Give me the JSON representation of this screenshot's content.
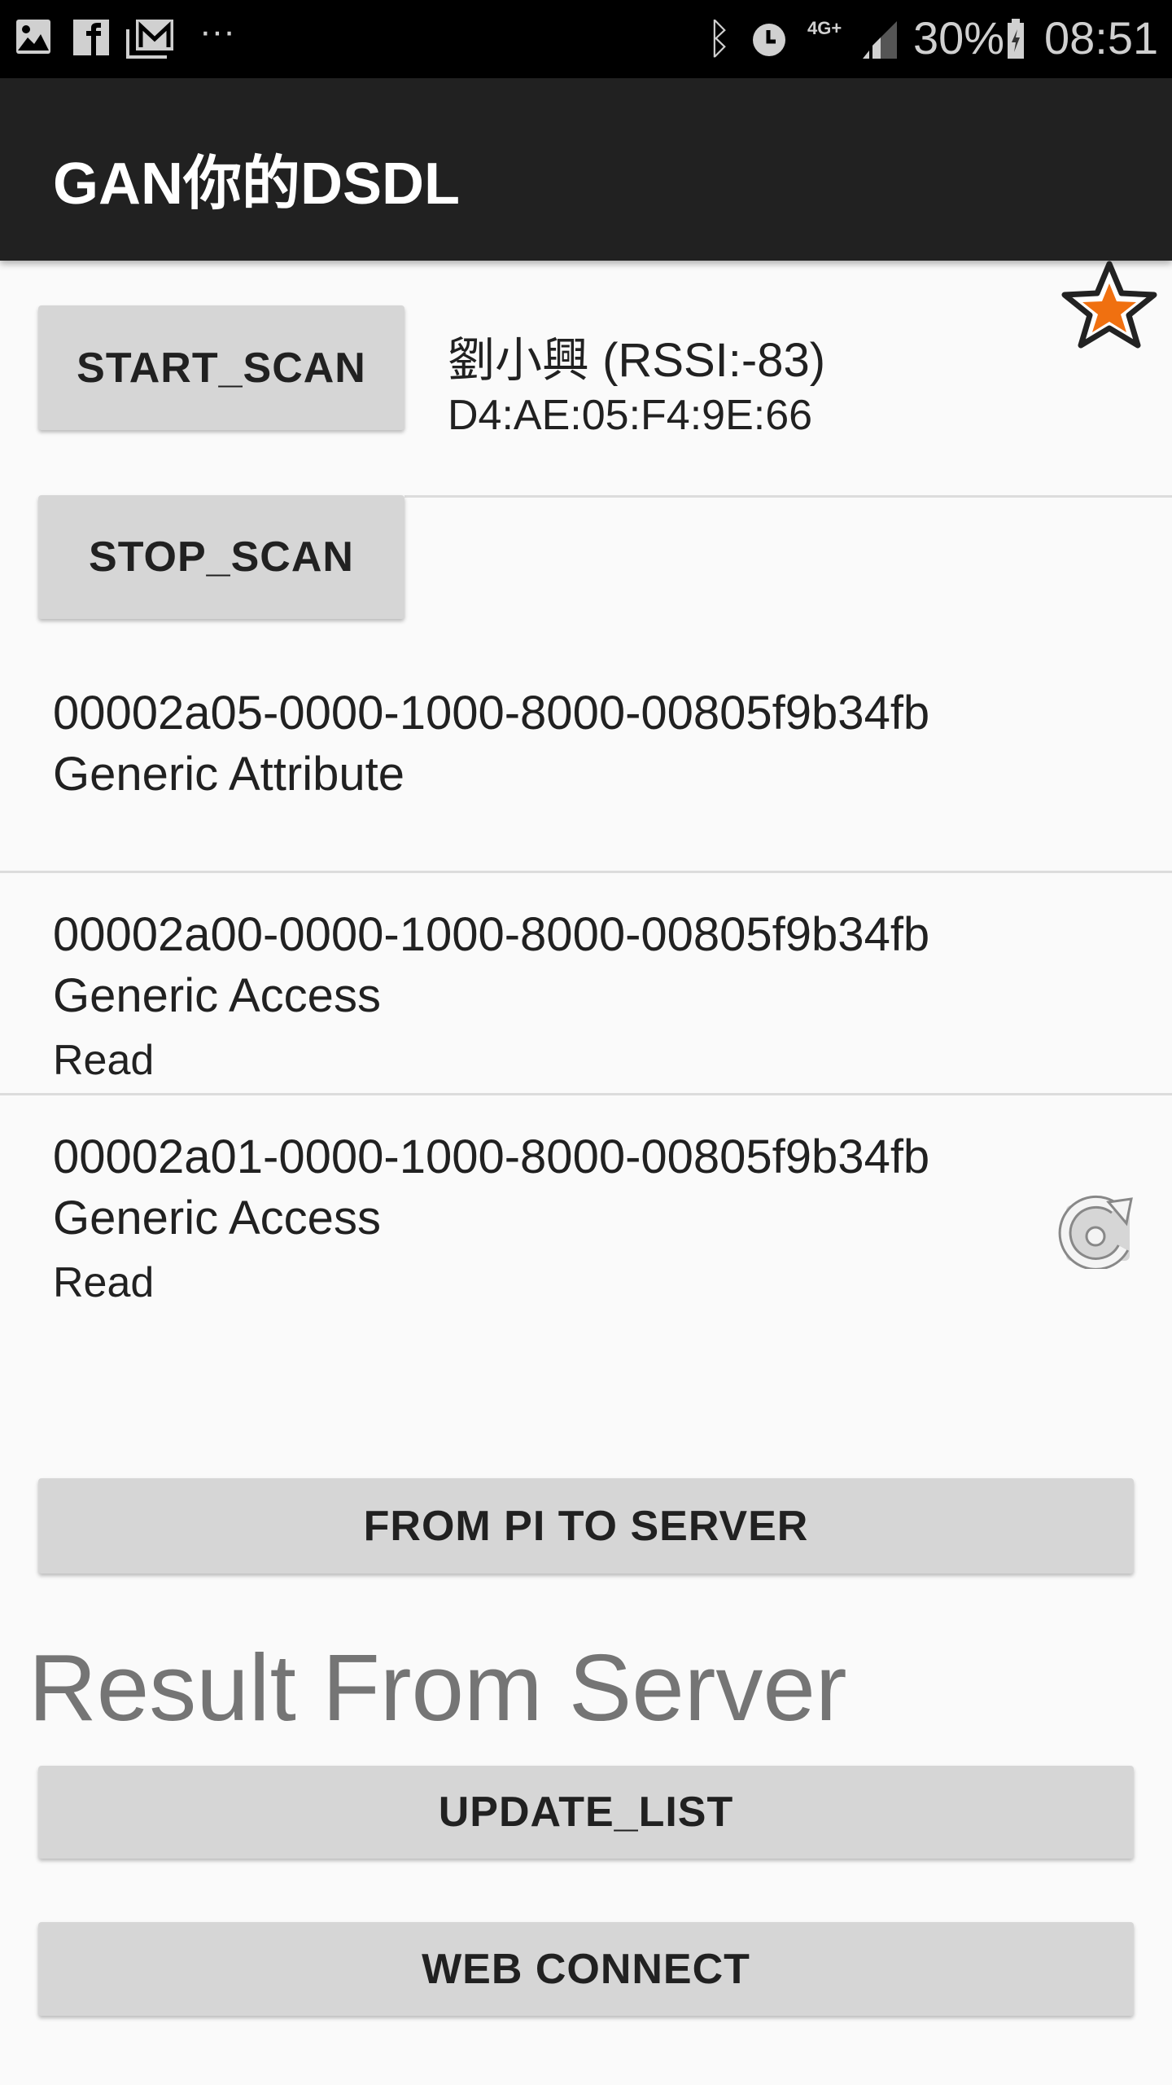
{
  "status_bar": {
    "battery": "30%",
    "time": "08:51",
    "network": "4G+",
    "more": "···"
  },
  "app_bar": {
    "title": "GAN你的DSDL"
  },
  "buttons": {
    "start_scan": "START_SCAN",
    "stop_scan": "STOP_SCAN",
    "from_pi": "FROM PI TO SERVER",
    "update_list": "UPDATE_LIST",
    "web_connect": "WEB CONNECT"
  },
  "device": {
    "name": "劉小興 (RSSI:-83)",
    "address": "D4:AE:05:F4:9E:66"
  },
  "characteristics": [
    {
      "uuid": "00002a05-0000-1000-8000-00805f9b34fb",
      "service": "Generic Attribute",
      "property": ""
    },
    {
      "uuid": "00002a00-0000-1000-8000-00805f9b34fb",
      "service": "Generic Access",
      "property": "Read"
    },
    {
      "uuid": "00002a01-0000-1000-8000-00805f9b34fb",
      "service": "Generic Access",
      "property": "Read"
    }
  ],
  "result_heading": "Result From Server",
  "colors": {
    "app_bar": "#212121",
    "button": "#d6d6d6",
    "star": "#f07010"
  }
}
